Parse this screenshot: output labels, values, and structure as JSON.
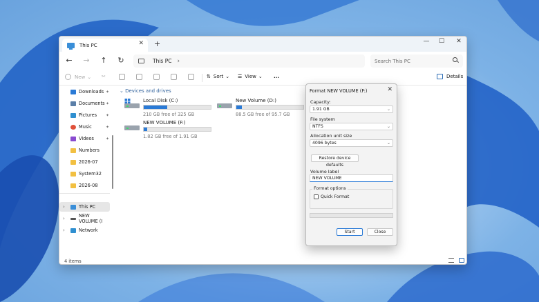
{
  "window": {
    "tab_title": "This PC",
    "address": "This PC",
    "search_placeholder": "Search This PC"
  },
  "toolbar": {
    "new_label": "New",
    "sort_label": "Sort",
    "view_label": "View",
    "more_label": "...",
    "details_label": "Details"
  },
  "sidebar": {
    "items": [
      {
        "label": "Downloads",
        "icon": "download-icon",
        "color": "#2a7ad6"
      },
      {
        "label": "Documents",
        "icon": "document-icon",
        "color": "#5b7fa8"
      },
      {
        "label": "Pictures",
        "icon": "picture-icon",
        "color": "#2f8fd0"
      },
      {
        "label": "Music",
        "icon": "music-icon",
        "color": "#e0503a"
      },
      {
        "label": "Videos",
        "icon": "video-icon",
        "color": "#8a4bd0"
      },
      {
        "label": "Numbers",
        "icon": "folder-icon",
        "color": "#f2c042"
      },
      {
        "label": "2026-07",
        "icon": "folder-icon",
        "color": "#f2c042"
      },
      {
        "label": "System32",
        "icon": "folder-icon",
        "color": "#f2c042"
      },
      {
        "label": "2026-08",
        "icon": "folder-icon",
        "color": "#f2c042"
      }
    ],
    "tree": [
      {
        "label": "This PC"
      },
      {
        "label": "NEW VOLUME (I"
      },
      {
        "label": "Network"
      }
    ]
  },
  "content": {
    "section_header": "Devices and drives",
    "drives": [
      {
        "name": "Local Disk (C:)",
        "free_text": "210 GB free of 325 GB",
        "used_fraction": 0.35
      },
      {
        "name": "New Volume (D:)",
        "free_text": "88.5 GB free of 95.7 GB",
        "used_fraction": 0.08
      },
      {
        "name": "NEW VOLUME (F:)",
        "free_text": "1.82 GB free of 1.91 GB",
        "used_fraction": 0.05
      }
    ],
    "status": "4 items"
  },
  "dialog": {
    "title": "Format NEW VOLUME (F:)",
    "capacity_label": "Capacity:",
    "capacity_value": "1.91 GB",
    "fs_label": "File system",
    "fs_value": "NTFS",
    "alloc_label": "Allocation unit size",
    "alloc_value": "4096 bytes",
    "restore_label": "Restore device defaults",
    "volume_label": "Volume label",
    "volume_value": "NEW VOLUME",
    "options_label": "Format options",
    "quick_format_label": "Quick Format",
    "start_label": "Start",
    "close_label": "Close"
  }
}
